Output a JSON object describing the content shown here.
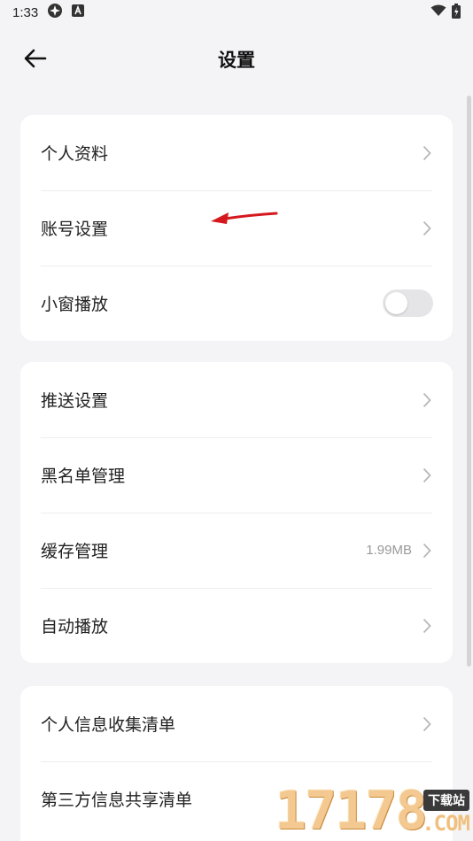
{
  "status_bar": {
    "time": "1:33",
    "icons_left": [
      "settings-app-icon",
      "a-badge-icon"
    ],
    "icons_right": [
      "wifi-icon",
      "battery-icon"
    ]
  },
  "header": {
    "title": "设置",
    "back_icon": "back-arrow-icon"
  },
  "cards": [
    {
      "rows": [
        {
          "label": "个人资料",
          "type": "link"
        },
        {
          "label": "账号设置",
          "type": "link"
        },
        {
          "label": "小窗播放",
          "type": "toggle",
          "on": false
        }
      ]
    },
    {
      "rows": [
        {
          "label": "推送设置",
          "type": "link"
        },
        {
          "label": "黑名单管理",
          "type": "link"
        },
        {
          "label": "缓存管理",
          "type": "link",
          "value": "1.99MB"
        },
        {
          "label": "自动播放",
          "type": "link"
        }
      ]
    },
    {
      "rows": [
        {
          "label": "个人信息收集清单",
          "type": "link"
        },
        {
          "label": "第三方信息共享清单",
          "type": "link"
        }
      ]
    }
  ],
  "annotation": {
    "icon": "red-arrow-icon",
    "color": "#d4181e"
  },
  "watermark": {
    "digits": "17178",
    "badge": "下载站",
    "suffix": ".COM"
  },
  "colors": {
    "background": "#f4f4f6",
    "card": "#ffffff",
    "text": "#222222",
    "secondary_text": "#999999",
    "chevron": "#b8b8ba",
    "toggle_off": "#e5e5e7"
  }
}
